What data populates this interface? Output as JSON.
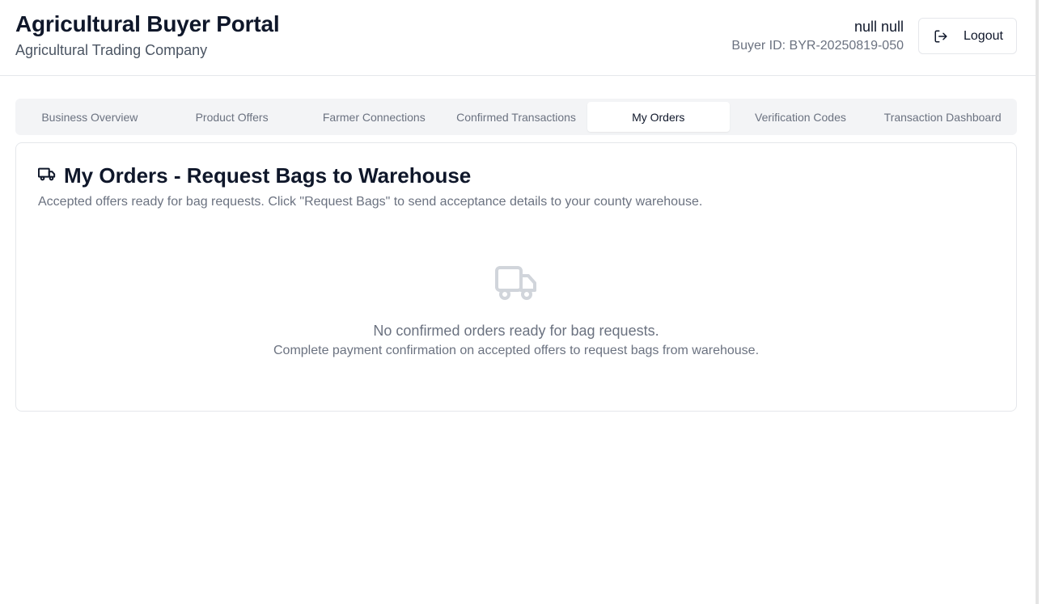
{
  "header": {
    "title": "Agricultural Buyer Portal",
    "subtitle": "Agricultural Trading Company",
    "user_name": "null null",
    "buyer_id": "Buyer ID: BYR-20250819-050",
    "logout_label": "Logout",
    "logout_icon": "logout-icon"
  },
  "tabs": [
    {
      "label": "Business Overview",
      "active": false
    },
    {
      "label": "Product Offers",
      "active": false
    },
    {
      "label": "Farmer Connections",
      "active": false
    },
    {
      "label": "Confirmed Transactions",
      "active": false
    },
    {
      "label": "My Orders",
      "active": true
    },
    {
      "label": "Verification Codes",
      "active": false
    },
    {
      "label": "Transaction Dashboard",
      "active": false
    }
  ],
  "card": {
    "icon": "truck-icon",
    "title": "My Orders - Request Bags to Warehouse",
    "description": "Accepted offers ready for bag requests. Click \"Request Bags\" to send acceptance details to your county warehouse.",
    "empty_icon": "truck-icon",
    "empty_title": "No confirmed orders ready for bag requests.",
    "empty_subtitle": "Complete payment confirmation on accepted offers to request bags from warehouse."
  },
  "colors": {
    "text_primary": "#0f172a",
    "text_muted": "#6b7280",
    "tab_bg": "#f3f4f6",
    "border": "#e5e7eb",
    "empty_icon": "#d1d5db"
  }
}
